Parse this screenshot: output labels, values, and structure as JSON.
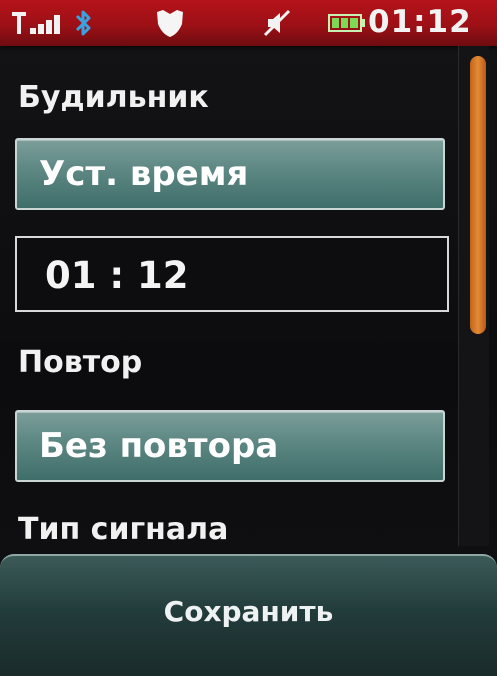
{
  "status_bar": {
    "clock": "01:12",
    "icons": [
      "signal-icon",
      "bluetooth-icon",
      "shield-icon",
      "mute-icon",
      "battery-icon"
    ],
    "colors": {
      "bar": "#a51218",
      "battery": "#7ed957",
      "bluetooth": "#3aa2e0"
    }
  },
  "alarm": {
    "title": "Будильник",
    "set_time_button": "Уст. время",
    "time_value": "01 : 12",
    "repeat_label": "Повтор",
    "repeat_value": "Без повтора",
    "signal_type_label": "Тип сигнала"
  },
  "softkeys": {
    "save_label": "Сохранить"
  },
  "scrollbar": {
    "accent": "#e0822f"
  }
}
